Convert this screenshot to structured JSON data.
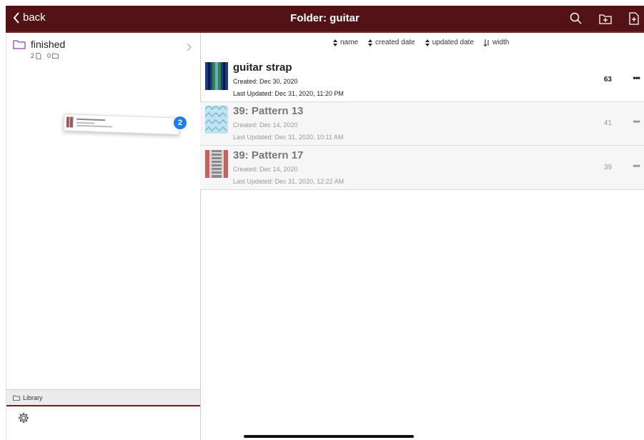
{
  "header": {
    "back_label": "back",
    "title": "Folder: guitar",
    "icons": [
      "search-icon",
      "new-folder-icon",
      "new-file-icon"
    ]
  },
  "sidebar": {
    "folder": {
      "name": "finished",
      "file_count": "2",
      "folder_count": "0"
    },
    "drag_badge": "2",
    "library_label": "Library"
  },
  "sort": [
    {
      "label": "name",
      "icon": "sort-toggle-icon"
    },
    {
      "label": "created date",
      "icon": "sort-toggle-icon"
    },
    {
      "label": "updated date",
      "icon": "sort-toggle-icon"
    },
    {
      "label": "width",
      "icon": "sort-descending-icon"
    }
  ],
  "patterns": [
    {
      "name": "guitar strap",
      "created": "Created: Dec 30, 2020",
      "updated": "Last Updated: Dec 31, 2020, 11:20 PM",
      "width": "63",
      "more": "•••"
    },
    {
      "name": "39: Pattern 13",
      "created": "Created: Dec 14, 2020",
      "updated": "Last Updated: Dec 31, 2020, 10:11 AM",
      "width": "41",
      "more": "•••"
    },
    {
      "name": "39: Pattern 17",
      "created": "Created: Dec 14, 2020",
      "updated": "Last Updated: Dec 31, 2020, 12:22 AM",
      "width": "39",
      "more": "•••"
    }
  ],
  "colors": {
    "header_bg": "#531316",
    "accent": "#7a1a1d",
    "folder_icon": "#9b3fbf",
    "badge": "#1e7cf2"
  }
}
